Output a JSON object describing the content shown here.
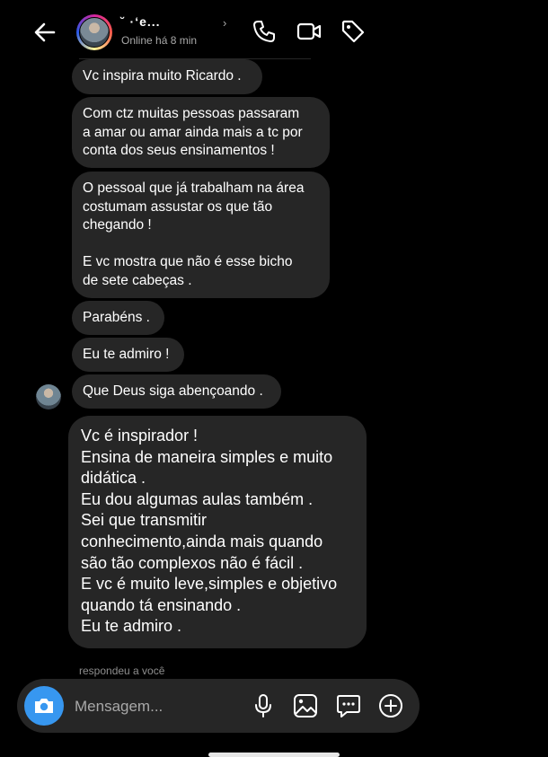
{
  "header": {
    "contact_name": "˘ ·‘e...",
    "status": "Online há 8 min",
    "icons": [
      "back-arrow-icon",
      "phone-icon",
      "video-camera-icon",
      "tag-icon"
    ]
  },
  "messages": [
    "Vc inspira muito Ricardo .",
    "Com ctz muitas pessoas passaram\na amar ou amar ainda mais a tc por\nconta dos seus ensinamentos !",
    "O pessoal que já trabalham na área\ncostumam assustar os que tão\nchegando !\n\nE vc mostra que não é esse bicho\nde sete cabeças .",
    "Parabéns .",
    "Eu te admiro !",
    "Que Deus siga abençoando .",
    "Vc é inspirador !\nEnsina de maneira simples e muito\ndidática .\nEu dou algumas aulas também .\nSei que transmitir\nconhecimento,ainda mais quando\nsão tão complexos não é fácil .\nE vc é muito leve,simples e objetivo\nquando tá ensinando .\nEu te admiro ."
  ],
  "replied_label": "respondeu a você",
  "composer": {
    "placeholder": "Mensagem...",
    "icons": [
      "camera-icon",
      "microphone-icon",
      "gallery-icon",
      "sticker-icon",
      "plus-icon"
    ]
  },
  "colors": {
    "background": "#000000",
    "bubble": "#262626",
    "accent": "#3797f0",
    "muted_text": "#a8a8a8"
  }
}
